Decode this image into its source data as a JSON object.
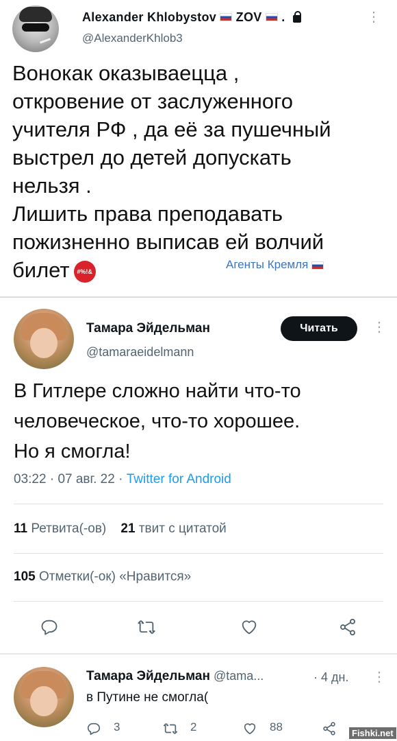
{
  "top_tweet": {
    "name": "Alexander Khlobystov",
    "name_suffix": "ZOV",
    "name_dot": ".",
    "handle": "@AlexanderKhlob3",
    "text_lines": [
      "Вонокак оказываецца ,",
      "откровение от заслуженного",
      "учителя РФ , да её за пушечный",
      "выстрел до детей допускать",
      "нельзя .",
      "Лишить права преподавать",
      "пожизненно выписав ей волчий",
      "билет"
    ],
    "emoji_text": "#%!&",
    "caption": "Агенты Кремля",
    "more_glyph": "⋮"
  },
  "quoted_tweet": {
    "name": "Тамара Эйдельман",
    "handle": "@tamaraeidelmann",
    "follow_label": "Читать",
    "text_lines": [
      "В Гитлере сложно найти что-то",
      "человеческое, что-то хорошее.",
      "Но я смогла!"
    ],
    "time": "03:22",
    "date": "07 авг. 22",
    "separator": "·",
    "source": "Twitter for Android",
    "retweets_count": "11",
    "retweets_label": "Ретвита(-ов)",
    "quotes_count": "21",
    "quotes_label": "твит с цитатой",
    "likes_count": "105",
    "likes_label": "Отметки(-ок) «Нравится»",
    "more_glyph": "⋮"
  },
  "reply": {
    "name": "Тамара Эйдельман",
    "handle_truncated": "@tama...",
    "time": "· 4 дн.",
    "text": "в Путине не смогла(",
    "replies": "3",
    "retweets": "2",
    "likes": "88",
    "more_glyph": "⋮"
  },
  "watermark": "Fishki.net",
  "colors": {
    "link": "#1d9bf0",
    "caption": "#3a75c4",
    "secondary": "#536471",
    "follow_bg": "#0f1419"
  },
  "icons": [
    "reply-icon",
    "retweet-icon",
    "like-icon",
    "share-icon"
  ]
}
